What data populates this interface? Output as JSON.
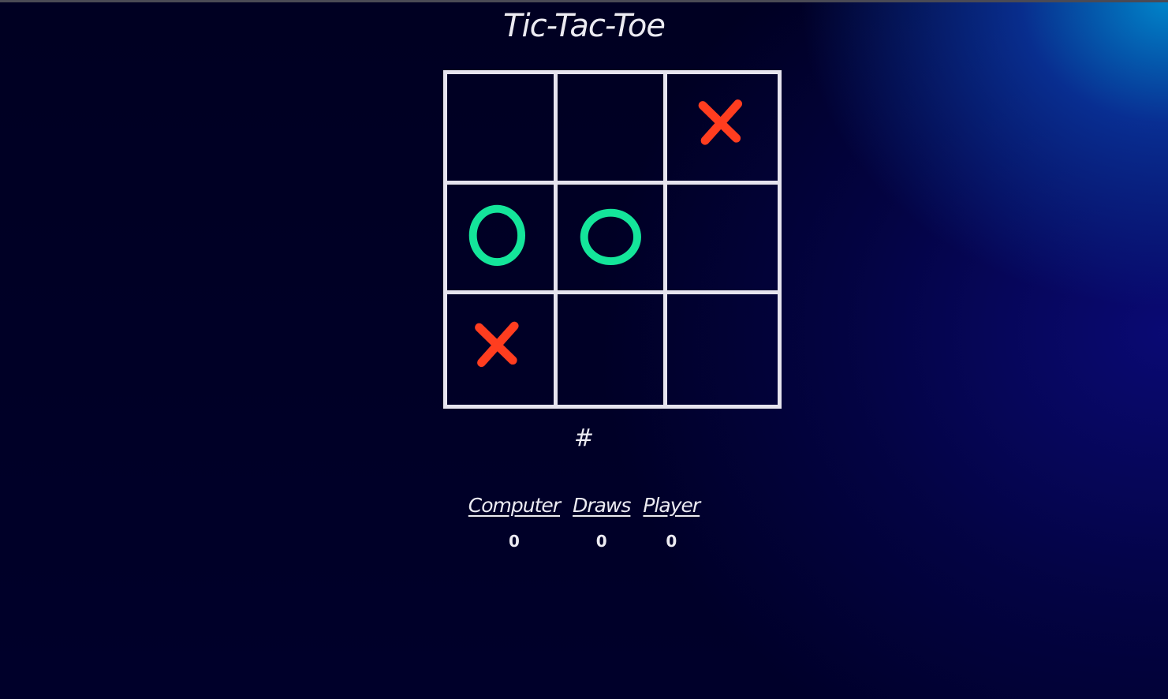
{
  "title": "Tic-Tac-Toe",
  "board": {
    "cells": [
      "",
      "",
      "X",
      "O",
      "O",
      "",
      "X",
      "",
      ""
    ]
  },
  "turn_indicator": "#",
  "scoreboard": {
    "computer_label": "Computer",
    "draws_label": "Draws",
    "player_label": "Player",
    "computer_score": "0",
    "draws_score": "0",
    "player_score": "0"
  },
  "colors": {
    "x_mark": "#ff3d1f",
    "o_mark": "#14e59a",
    "grid": "#e6e4ee",
    "text": "#ecebf2"
  }
}
